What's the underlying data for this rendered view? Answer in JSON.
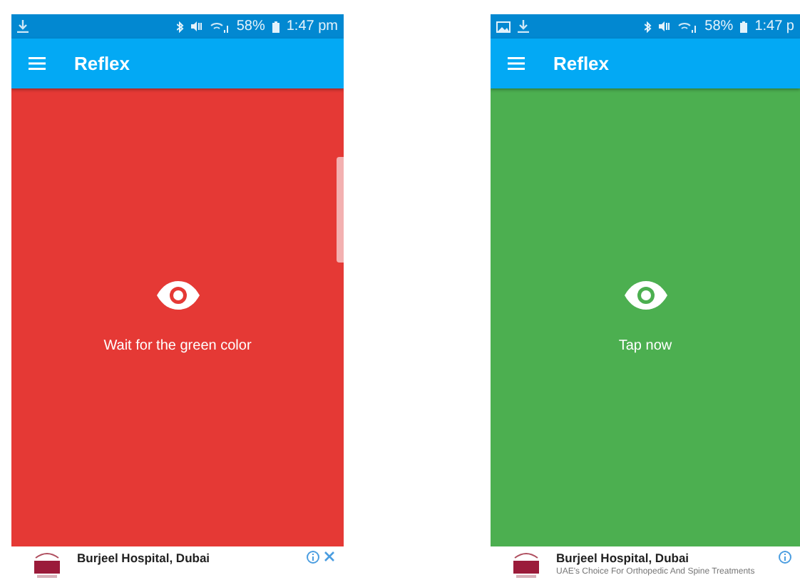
{
  "phones": [
    {
      "status": {
        "notification_icons": [
          {
            "kind": "download"
          }
        ],
        "battery": "58%",
        "time": "1:47 pm"
      },
      "app_bar": {
        "title": "Reflex"
      },
      "screen": {
        "kind": "wait",
        "message": "Wait for the green color",
        "side_handle": true
      },
      "ad": {
        "title": "Burjeel Hospital, Dubai",
        "close": true
      }
    },
    {
      "status": {
        "notification_icons": [
          {
            "kind": "image"
          },
          {
            "kind": "download"
          }
        ],
        "battery": "58%",
        "time": "1:47 p"
      },
      "app_bar": {
        "title": "Reflex"
      },
      "screen": {
        "kind": "go",
        "message": "Tap now",
        "side_handle": false
      },
      "ad": {
        "title": "Burjeel Hospital, Dubai",
        "subtitle": "UAE's Choice For Orthopedic And Spine Treatments",
        "close": false
      }
    }
  ]
}
